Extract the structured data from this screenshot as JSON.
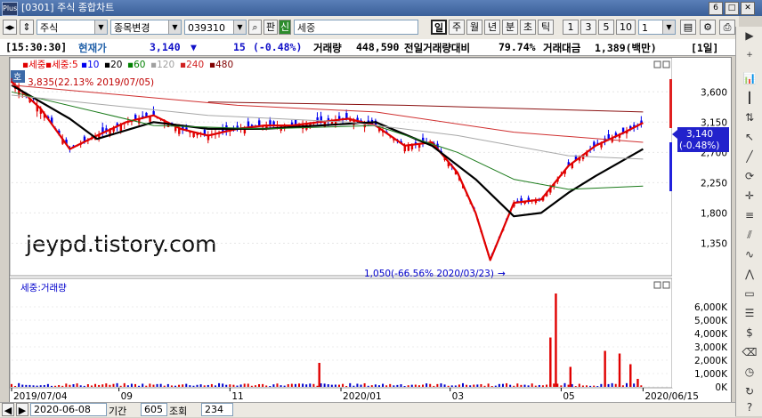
{
  "window": {
    "code": "[0301]",
    "title": "주식 종합차트",
    "logo": "Plus",
    "buttons": [
      "6",
      "□",
      "✕"
    ]
  },
  "toolbar": {
    "market": "주식",
    "change_label": "종목변경",
    "code": "039310",
    "pan_label": "판",
    "shin_label": "신",
    "name": "세중",
    "periods": [
      "일",
      "주",
      "월",
      "년",
      "분",
      "초",
      "틱"
    ],
    "selected_period": "일",
    "numbers": [
      "1",
      "3",
      "5",
      "10"
    ],
    "count_value": "1"
  },
  "info": {
    "time": "[15:30:30]",
    "price_label": "현재가",
    "price": "3,140",
    "change_arrow": "▼",
    "change": "15",
    "change_pct": "(-0.48%)",
    "volume_label": "거래량",
    "volume": "448,590",
    "prev_vol_label": "전일거래량대비",
    "prev_vol_pct": "79.74%",
    "amount_label": "거래대금",
    "amount": "1,389(백만)",
    "period_badge": "[1일]"
  },
  "price_chart": {
    "legend": [
      "세중",
      "세중:5",
      "10",
      "20",
      "60",
      "120",
      "240",
      "480"
    ],
    "legend_colors": [
      "#e00000",
      "#e00000",
      "#0000ee",
      "#000000",
      "#008000",
      "#a0a0a0",
      "#d02020",
      "#800000"
    ],
    "badge": "호",
    "high_note": "3,835(22.13% 2019/07/05)",
    "low_note": "1,050(-66.56% 2020/03/23)",
    "current_price": "3,140",
    "current_pct": "(-0.48%)"
  },
  "volume_chart": {
    "legend": "세중:거래량"
  },
  "watermark": "jeypd.tistory.com",
  "chart_data": [
    {
      "type": "line",
      "title": "",
      "y_ticks": [
        "3,600",
        "3,150",
        "2,700",
        "2,250",
        "1,800",
        "1,350"
      ],
      "y_tick_values": [
        3600,
        3150,
        2700,
        2250,
        1800,
        1350
      ],
      "ylim": [
        880,
        4000
      ],
      "x_ticks": [
        "2019/07/04",
        "09",
        "11",
        "2020/01",
        "03",
        "05",
        "2020/06/15"
      ],
      "x_tick_dates": [
        "2019-07-04",
        "2019-09-01",
        "2019-11-01",
        "2020-01-01",
        "2020-03-01",
        "2020-05-01",
        "2020-06-15"
      ],
      "series": [
        {
          "name": "세중",
          "x": [
            "2019-07-04",
            "2019-07-20",
            "2019-08-05",
            "2019-08-20",
            "2019-09-05",
            "2019-09-20",
            "2019-10-05",
            "2019-10-20",
            "2019-11-05",
            "2019-11-20",
            "2019-12-05",
            "2019-12-20",
            "2020-01-05",
            "2020-01-20",
            "2020-02-05",
            "2020-02-20",
            "2020-03-05",
            "2020-03-15",
            "2020-03-23",
            "2020-04-05",
            "2020-04-20",
            "2020-05-05",
            "2020-05-20",
            "2020-06-05",
            "2020-06-15"
          ],
          "values": [
            3750,
            3350,
            2750,
            2950,
            3150,
            3250,
            3050,
            2950,
            3050,
            3100,
            3100,
            3150,
            3200,
            3100,
            2800,
            2850,
            2400,
            1800,
            1100,
            1950,
            2000,
            2500,
            2800,
            3000,
            3140
          ]
        },
        {
          "name": "20",
          "x": [
            "2019-07-04",
            "2019-08-05",
            "2019-08-20",
            "2019-09-20",
            "2019-10-20",
            "2019-11-20",
            "2019-12-20",
            "2020-01-20",
            "2020-02-20",
            "2020-03-15",
            "2020-04-05",
            "2020-04-20",
            "2020-05-05",
            "2020-05-20",
            "2020-06-15"
          ],
          "values": [
            3700,
            3200,
            2900,
            3150,
            3050,
            3050,
            3100,
            3150,
            2800,
            2300,
            1750,
            1800,
            2100,
            2350,
            2750
          ]
        },
        {
          "name": "60",
          "x": [
            "2019-07-04",
            "2019-09-20",
            "2019-11-20",
            "2020-01-20",
            "2020-03-05",
            "2020-04-05",
            "2020-05-05",
            "2020-06-15"
          ],
          "values": [
            3600,
            3100,
            3050,
            3100,
            2700,
            2300,
            2150,
            2200
          ]
        },
        {
          "name": "120",
          "x": [
            "2019-07-04",
            "2019-10-20",
            "2020-01-05",
            "2020-03-05",
            "2020-05-05",
            "2020-06-15"
          ],
          "values": [
            3550,
            3250,
            3150,
            2950,
            2650,
            2600
          ]
        },
        {
          "name": "240",
          "x": [
            "2019-07-04",
            "2019-11-05",
            "2020-01-20",
            "2020-04-05",
            "2020-06-15"
          ],
          "values": [
            3700,
            3400,
            3300,
            3000,
            2850
          ]
        },
        {
          "name": "480",
          "x": [
            "2019-10-20",
            "2020-02-05",
            "2020-06-15"
          ],
          "values": [
            3450,
            3400,
            3300
          ]
        }
      ]
    },
    {
      "type": "bar",
      "title": "",
      "y_ticks": [
        "6,000K",
        "5,000K",
        "4,000K",
        "3,000K",
        "2,000K",
        "1,000K",
        "0K"
      ],
      "y_tick_values": [
        6000,
        5000,
        4000,
        3000,
        2000,
        1000,
        0
      ],
      "ylim": [
        0,
        7200
      ],
      "x": [
        "2019-12-20",
        "2020-04-25",
        "2020-04-28",
        "2020-05-06",
        "2020-05-25",
        "2020-06-02",
        "2020-06-08",
        "2020-06-12"
      ],
      "values": [
        1800,
        3700,
        7000,
        1500,
        2700,
        2500,
        1700,
        600
      ]
    }
  ]
}
